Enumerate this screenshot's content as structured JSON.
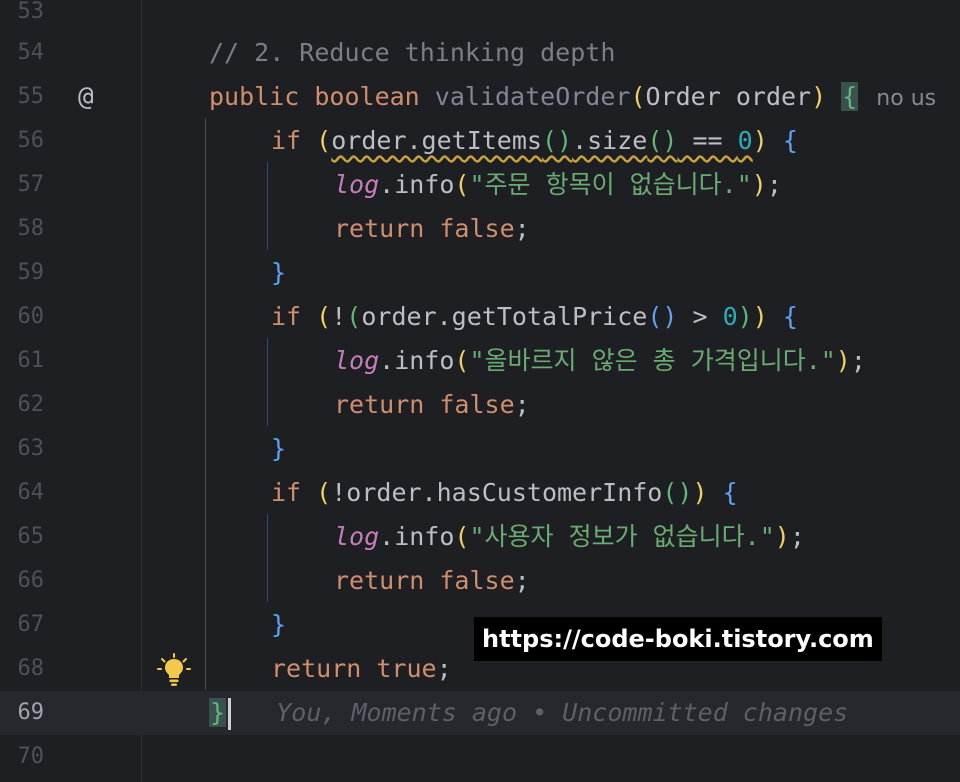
{
  "editor": {
    "current_line": "69",
    "gutter": {
      "line_numbers": [
        "53",
        "54",
        "55",
        "56",
        "57",
        "58",
        "59",
        "60",
        "61",
        "62",
        "63",
        "64",
        "65",
        "66",
        "67",
        "68",
        "69",
        "70"
      ],
      "override_marker": "@",
      "bulb_icon": "lightbulb-icon"
    },
    "code": {
      "l54": {
        "comment": "// 2. Reduce thinking depth"
      },
      "l55": {
        "kw1": "public",
        "kw2": "boolean",
        "method": "validateOrder",
        "open_paren": "(",
        "param": "Order order",
        "close_paren": ")",
        "brace": "{",
        "inlay_hint": "no us"
      },
      "l56": {
        "kw": "if",
        "p1": "(",
        "expr_a": "order.getItems",
        "p2": "()",
        "dot": ".size",
        "p3": "()",
        "op": " == ",
        "num": "0",
        "p4": ")",
        "brace": "{"
      },
      "l57": {
        "field": "log",
        "call": ".info",
        "p1": "(",
        "str": "\"주문 항목이 없습니다.\"",
        "p2": ")",
        "semi": ";"
      },
      "l58": {
        "kw1": "return",
        "kw2": "false",
        "semi": ";"
      },
      "l59": {
        "brace": "}"
      },
      "l60": {
        "kw": "if",
        "p1": "(",
        "bang": "!",
        "p2": "(",
        "expr": "order.getTotalPrice",
        "p3": "()",
        "op": " > ",
        "num": "0",
        "p4": ")",
        "p5": ")",
        "brace": "{"
      },
      "l61": {
        "field": "log",
        "call": ".info",
        "p1": "(",
        "str": "\"올바르지 않은 총 가격입니다.\"",
        "p2": ")",
        "semi": ";"
      },
      "l62": {
        "kw1": "return",
        "kw2": "false",
        "semi": ";"
      },
      "l63": {
        "brace": "}"
      },
      "l64": {
        "kw": "if",
        "p1": "(",
        "expr": "!order.hasCustomerInfo",
        "p2": "()",
        "p3": ")",
        "brace": "{"
      },
      "l65": {
        "field": "log",
        "call": ".info",
        "p1": "(",
        "str": "\"사용자 정보가 없습니다.\"",
        "p2": ")",
        "semi": ";"
      },
      "l66": {
        "kw1": "return",
        "kw2": "false",
        "semi": ";"
      },
      "l67": {
        "brace": "}"
      },
      "l68": {
        "kw1": "return",
        "kw2": "true",
        "semi": ";"
      },
      "l69": {
        "brace": "}",
        "blame": "You, Moments ago • Uncommitted changes"
      }
    }
  },
  "watermark": "https://code-boki.tistory.com",
  "colors": {
    "background": "#1e1f22",
    "keyword": "#cf8e6d",
    "function": "#56a8f5",
    "string": "#6aab73",
    "number": "#2aacb8",
    "field": "#c77dbb",
    "comment": "#7a7e85"
  }
}
